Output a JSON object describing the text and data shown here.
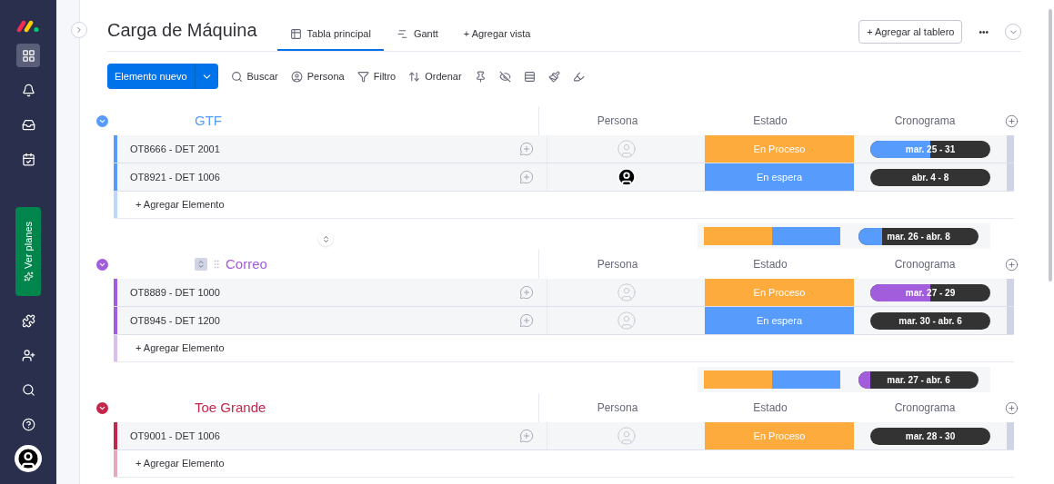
{
  "board": {
    "title": "Carga de Máquina",
    "views": [
      {
        "label": "Tabla principal",
        "selected": true
      },
      {
        "label": "Gantt",
        "selected": false
      },
      {
        "label": "+ Agregar vista",
        "selected": false
      }
    ],
    "add_to_board": "+ Agregar al tablero",
    "more": "•••"
  },
  "sidebar": {
    "plans_button": "Ver planes"
  },
  "toolbar": {
    "new_item": "Elemento nuevo",
    "items": [
      {
        "label": "Buscar"
      },
      {
        "label": "Persona"
      },
      {
        "label": "Filtro"
      },
      {
        "label": "Ordenar"
      }
    ]
  },
  "groups": [
    {
      "name": "GTF",
      "color": "#579bfc",
      "hovered": false,
      "columns": [
        "Persona",
        "Estado",
        "Cronograma"
      ],
      "rows": [
        {
          "name": "OT8666 - DET 2001",
          "person_assigned": false,
          "status": {
            "label": "En Proceso",
            "color": "#fdab3d"
          },
          "timeline": {
            "label": "mar. 25 - 31",
            "level": 0.5
          }
        },
        {
          "name": "OT8921 - DET 1006",
          "person_assigned": true,
          "status": {
            "label": "En espera",
            "color": "#579bfc"
          },
          "timeline": {
            "label": "abr. 4 - 8"
          }
        }
      ],
      "add_item": "+ Agregar Elemento",
      "summary": {
        "segments": [
          {
            "color": "#fdab3d"
          },
          {
            "color": "#579bfc"
          }
        ],
        "timeline": {
          "label": "mar. 26 - abr. 8",
          "level": 0.2
        }
      }
    },
    {
      "name": "Correo",
      "color": "#a25ddc",
      "hovered": true,
      "columns": [
        "Persona",
        "Estado",
        "Cronograma"
      ],
      "rows": [
        {
          "name": "OT8889 - DET 1000",
          "person_assigned": false,
          "status": {
            "label": "En Proceso",
            "color": "#fdab3d"
          },
          "timeline": {
            "label": "mar. 27 - 29",
            "level": 0.5
          }
        },
        {
          "name": "OT8945 - DET 1200",
          "person_assigned": false,
          "status": {
            "label": "En espera",
            "color": "#579bfc"
          },
          "timeline": {
            "label": "mar. 30 - abr. 6"
          }
        }
      ],
      "add_item": "+ Agregar Elemento",
      "summary": {
        "segments": [
          {
            "color": "#fdab3d"
          },
          {
            "color": "#579bfc"
          }
        ],
        "timeline": {
          "label": "mar. 27 - abr. 6",
          "level": 0.1
        }
      }
    },
    {
      "name": "Toe Grande",
      "color": "#c4264b",
      "hovered": false,
      "columns": [
        "Persona",
        "Estado",
        "Cronograma"
      ],
      "rows": [
        {
          "name": "OT9001 - DET 1006",
          "person_assigned": false,
          "status": {
            "label": "En Proceso",
            "color": "#fdab3d"
          },
          "timeline": {
            "label": "mar. 28 - 30"
          }
        }
      ],
      "add_item": "+ Agregar Elemento"
    }
  ]
}
